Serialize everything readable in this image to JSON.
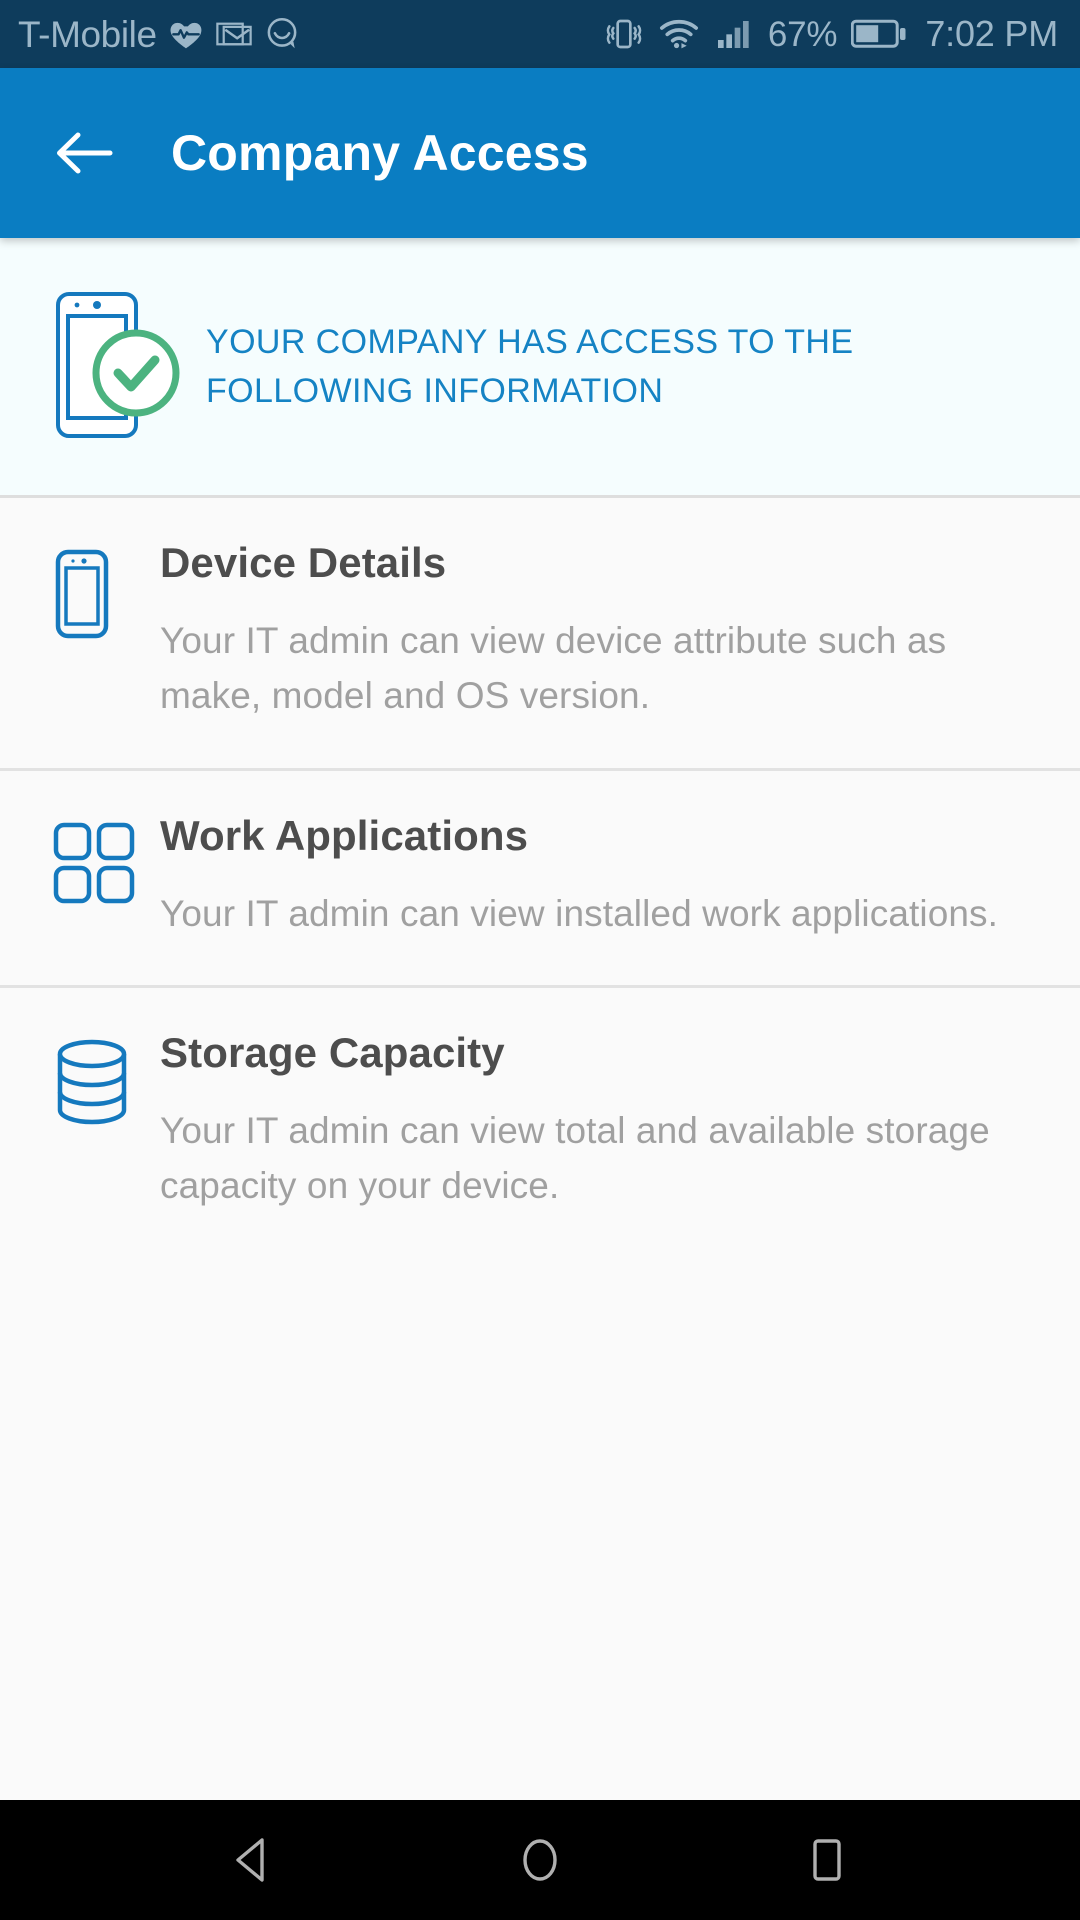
{
  "status_bar": {
    "carrier": "T-Mobile",
    "battery_percent": "67%",
    "time": "7:02 PM",
    "icons": [
      "heart-pulse-icon",
      "gmail-icon",
      "chat-bubble-icon",
      "vibrate-icon",
      "wifi-icon",
      "signal-bars-icon",
      "battery-icon"
    ],
    "background_color": "#0E3C5C",
    "text_color": "#9BB6C8"
  },
  "app_bar": {
    "title": "Company Access",
    "back_icon": "arrow-left-icon",
    "background_color": "#0A7DC2",
    "title_color": "#FFFFFF"
  },
  "banner": {
    "icon": "phone-with-check-icon",
    "text": "YOUR COMPANY HAS ACCESS TO THE FOLLOWING INFORMATION",
    "text_color": "#1583C4",
    "background_color": "#F5FDFE",
    "phone_outline_color": "#1579BE",
    "check_circle_color": "#4CB380"
  },
  "items": [
    {
      "icon": "smartphone-icon",
      "title": "Device Details",
      "description": "Your IT admin can view device attribute such as make, model and OS version."
    },
    {
      "icon": "apps-grid-icon",
      "title": "Work Applications",
      "description": "Your IT admin can view installed work applications."
    },
    {
      "icon": "database-icon",
      "title": "Storage Capacity",
      "description": "Your IT admin can view total and available storage capacity on your device."
    }
  ],
  "list_style": {
    "title_color": "#4D4D4D",
    "description_color": "#A0A0A0",
    "icon_color": "#1579BE",
    "background_color": "#FAFAFA",
    "divider_color": "#E2E2E2"
  },
  "nav_bar": {
    "background_color": "#000000",
    "buttons": [
      {
        "name": "back-triangle-icon"
      },
      {
        "name": "home-circle-icon"
      },
      {
        "name": "recents-square-icon"
      }
    ]
  }
}
